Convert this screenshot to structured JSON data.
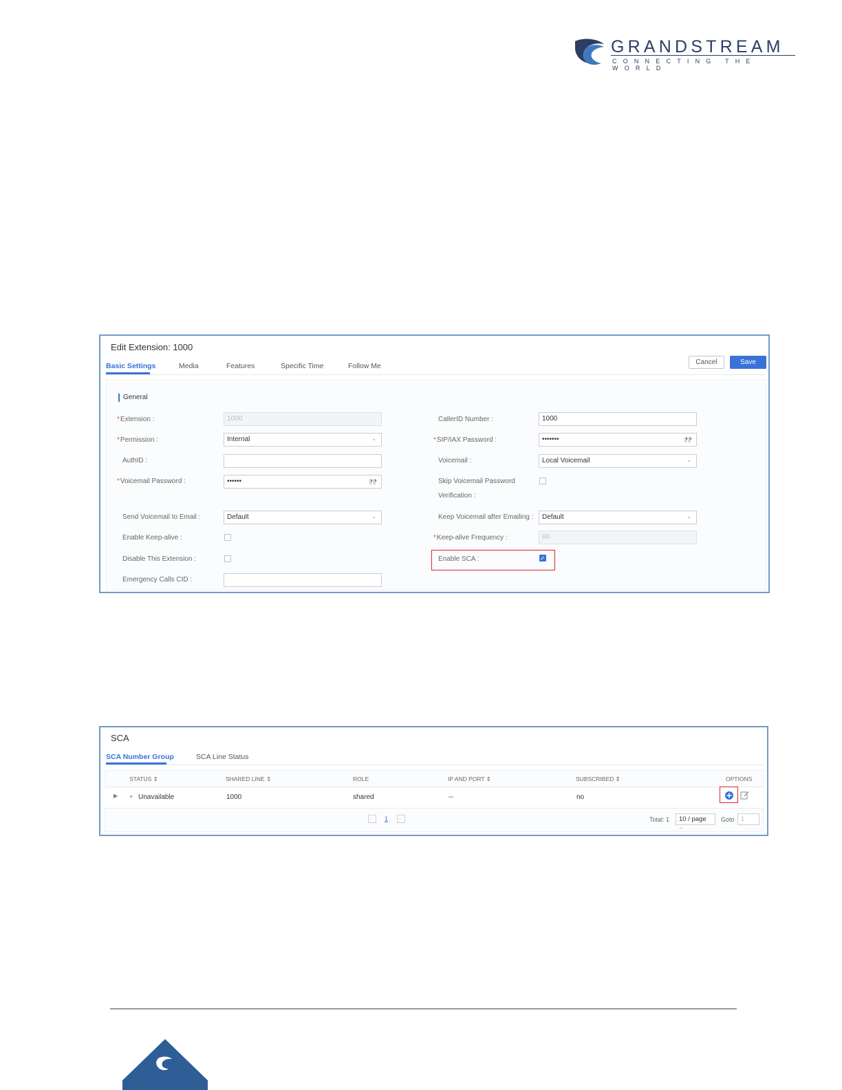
{
  "logo": {
    "brand": "GRANDSTREAM",
    "tagline": "CONNECTING THE WORLD",
    "colors": {
      "navy": "#2c3e63",
      "blue": "#2f6ab3"
    }
  },
  "edit_extension": {
    "title": "Edit Extension: 1000",
    "tabs": [
      "Basic Settings",
      "Media",
      "Features",
      "Specific Time",
      "Follow Me"
    ],
    "cancel_label": "Cancel",
    "save_label": "Save",
    "section_label": "General",
    "left_fields": {
      "extension": {
        "label": "Extension :",
        "value": "1000"
      },
      "permission": {
        "label": "Permission :",
        "value": "Internal"
      },
      "authid": {
        "label": "AuthID :",
        "value": ""
      },
      "voicemail_password": {
        "label": "Voicemail Password :",
        "value": "••••••"
      },
      "send_voicemail": {
        "label": "Send Voicemail to Email :",
        "value": "Default"
      },
      "keep_alive": {
        "label": "Enable Keep-alive :"
      },
      "disable_ext": {
        "label": "Disable This Extension :"
      },
      "emergency_cid": {
        "label": "Emergency Calls CID :",
        "value": ""
      }
    },
    "right_fields": {
      "callerid": {
        "label": "CallerID Number :",
        "value": "1000"
      },
      "sip_password": {
        "label": "SIP/IAX Password :",
        "value": "•••••••"
      },
      "voicemail": {
        "label": "Voicemail :",
        "value": "Local Voicemail"
      },
      "skip_vm_line1": "Skip Voicemail Password",
      "skip_vm_line2": "Verification :",
      "keep_vm": {
        "label": "Keep Voicemail after Emailing :",
        "value": "Default"
      },
      "keepalive_freq": {
        "label": "Keep-alive Frequency :",
        "value": "60"
      },
      "enable_sca": {
        "label": "Enable SCA :",
        "checkmark": "✓"
      }
    },
    "colors": {
      "accent": "#3773d8",
      "highlight": "#d9262c",
      "required": "#e05050"
    }
  },
  "sca": {
    "title": "SCA",
    "tabs": [
      "SCA Number Group",
      "SCA Line Status"
    ],
    "columns": [
      "STATUS",
      "SHARED LINE",
      "ROLE",
      "IP AND PORT",
      "SUBSCRIBED",
      "OPTIONS"
    ],
    "sort_glyph": "⇕",
    "row": {
      "status": "Unavailable",
      "shared_line": "1000",
      "role": "shared",
      "ip_port": "--",
      "subscribed": "no"
    },
    "pagination": {
      "page": "1",
      "total": "Total: 1",
      "page_size": "10 / page",
      "goto_label": "Goto",
      "goto_value": "1"
    }
  }
}
